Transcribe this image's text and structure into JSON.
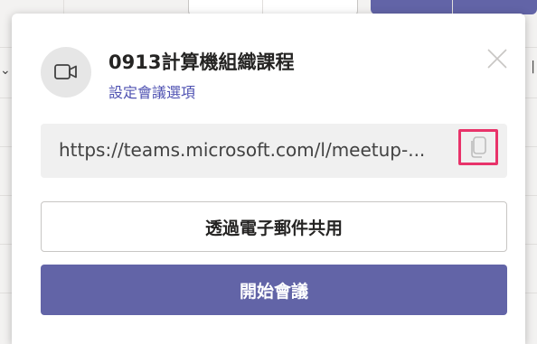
{
  "meeting": {
    "title": "0913計算機組織課程",
    "options_link": "設定會議選項",
    "url": "https://teams.microsoft.com/l/meetup-...",
    "share_email_label": "透過電子郵件共用",
    "start_label": "開始會議"
  },
  "colors": {
    "accent": "#6264a7",
    "link": "#4f52b2",
    "highlight": "#e8336a"
  },
  "icons": {
    "avatar": "video-camera-icon",
    "close": "close-icon",
    "copy": "copy-icon"
  }
}
